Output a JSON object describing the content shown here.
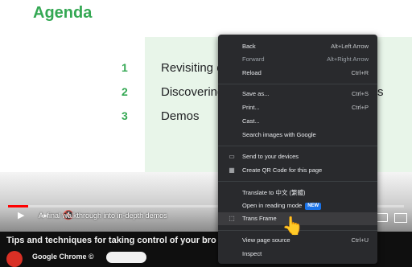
{
  "slide": {
    "title": "Agenda",
    "items": [
      {
        "num": "1",
        "text": "Revisiting e"
      },
      {
        "num": "2",
        "text": "Discovering"
      },
      {
        "num": "3",
        "text": "Demos"
      }
    ],
    "right_fragment": "s"
  },
  "player": {
    "caption": "A ​ final walkthrough into in-depth demos",
    "progress": 0.05
  },
  "video_title": "Tips and techniques for taking control of your bro",
  "channel_name": "Google Chrome ©",
  "context_menu": {
    "back": "Back",
    "back_shortcut": "Alt+Left Arrow",
    "forward": "Forward",
    "forward_shortcut": "Alt+Right Arrow",
    "reload": "Reload",
    "reload_shortcut": "Ctrl+R",
    "save_as": "Save as...",
    "save_as_shortcut": "Ctrl+S",
    "print": "Print...",
    "print_shortcut": "Ctrl+P",
    "cast": "Cast...",
    "search_images": "Search images with Google",
    "send_to_devices": "Send to your devices",
    "qr_code": "Create QR Code for this page",
    "translate": "Translate to 中文 (繁體)",
    "reading_mode": "Open in reading mode",
    "reading_mode_badge": "NEW",
    "trans_frame": "Trans Frame",
    "view_source": "View page source",
    "view_source_shortcut": "Ctrl+U",
    "inspect": "Inspect"
  }
}
